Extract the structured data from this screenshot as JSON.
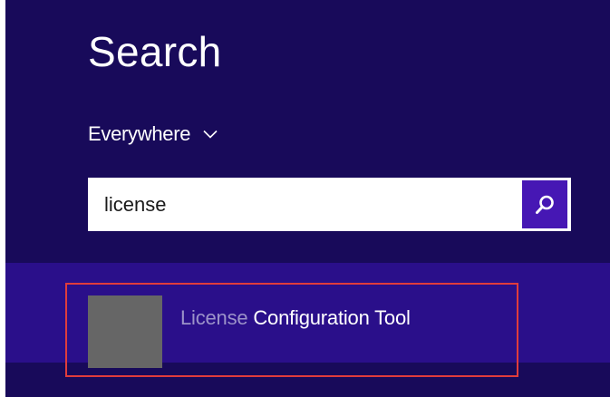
{
  "search_pane": {
    "title": "Search",
    "scope": {
      "selected": "Everywhere"
    },
    "search_box": {
      "value": "license"
    },
    "results": [
      {
        "match_text": "License",
        "rest_text": " Configuration Tool",
        "highlighted": true
      }
    ]
  },
  "colors": {
    "pane_background": "#180a5a",
    "results_band": "#2a0f8a",
    "search_button": "#4617b4",
    "highlight_border": "#e03c3c",
    "tile": "#666666"
  },
  "icons": {
    "scope_chevron": "chevron-down-icon",
    "search_button": "search-icon"
  }
}
